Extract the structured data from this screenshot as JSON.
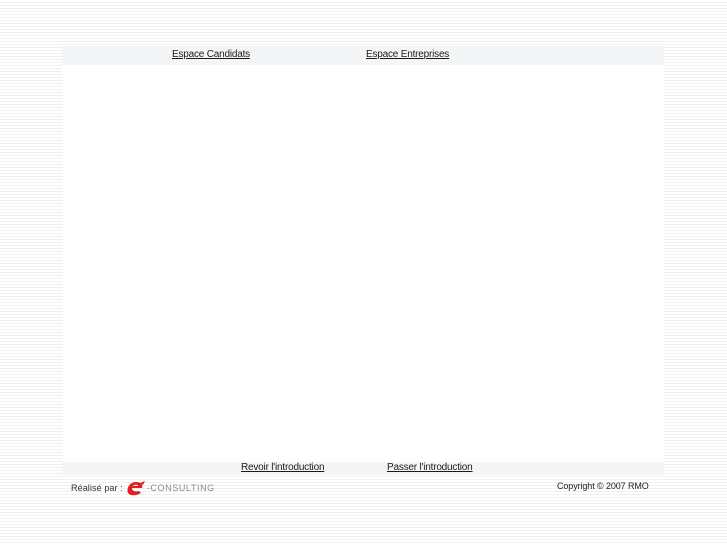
{
  "nav": {
    "candidats": "Espace Candidats",
    "entreprises": "Espace Entreprises"
  },
  "intro": {
    "revoir": "Revoir l'introduction",
    "passer": "Passer l'introduction"
  },
  "footer": {
    "credit_label": "Réalisé par :",
    "logo_name": "-CONSULTING",
    "logo_icon": "e-consulting-logo-icon",
    "copyright": "Copyright © 2007 RMO"
  },
  "colors": {
    "logo_red": "#e02020",
    "text": "#1a1a1a"
  }
}
